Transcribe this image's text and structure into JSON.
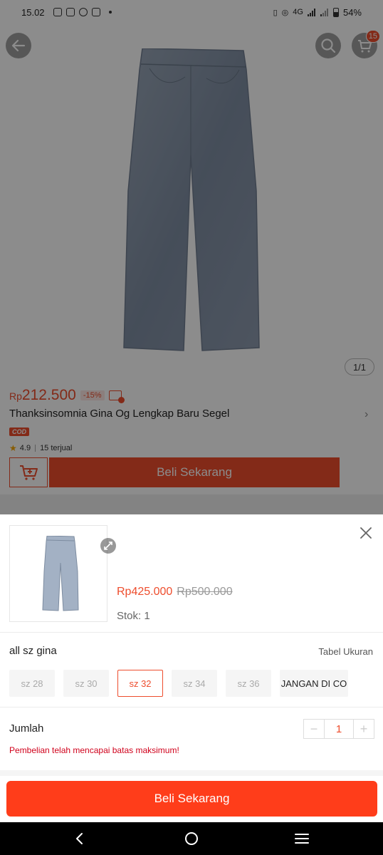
{
  "status_bar": {
    "time": "15.02",
    "network": "4G",
    "battery": "54%"
  },
  "header": {
    "cart_count": "15",
    "back_icon": "arrow-left-icon",
    "search_icon": "search-icon",
    "cart_icon": "cart-icon"
  },
  "gallery": {
    "pager": "1/1"
  },
  "product": {
    "currency": "Rp",
    "price": "212.500",
    "discount": "-15%",
    "title": "Thanksinsomnia Gina Og Lengkap Baru Segel",
    "cod_badge": "COD",
    "rating": "4.9",
    "sold": "15 terjual",
    "buy_now_label": "Beli Sekarang"
  },
  "sheet": {
    "price_now": "Rp425.000",
    "price_old": "Rp500.000",
    "stock": "Stok: 1",
    "variant_label": "all sz gina",
    "size_chart": "Tabel Ukuran",
    "sizes": [
      {
        "label": "sz 28",
        "state": "disabled"
      },
      {
        "label": "sz 30",
        "state": "disabled"
      },
      {
        "label": "sz 32",
        "state": "selected"
      },
      {
        "label": "sz 34",
        "state": "disabled"
      },
      {
        "label": "sz 36",
        "state": "disabled"
      },
      {
        "label": "JANGAN DI CO",
        "state": "enabled"
      }
    ],
    "quantity_label": "Jumlah",
    "quantity_value": "1",
    "limit_message": "Pembelian telah mencapai batas maksimum!",
    "buy_now_label": "Beli Sekarang"
  },
  "colors": {
    "brand": "#ee4d2d",
    "buy_button": "#ff3d1a",
    "error": "#d0011b"
  }
}
